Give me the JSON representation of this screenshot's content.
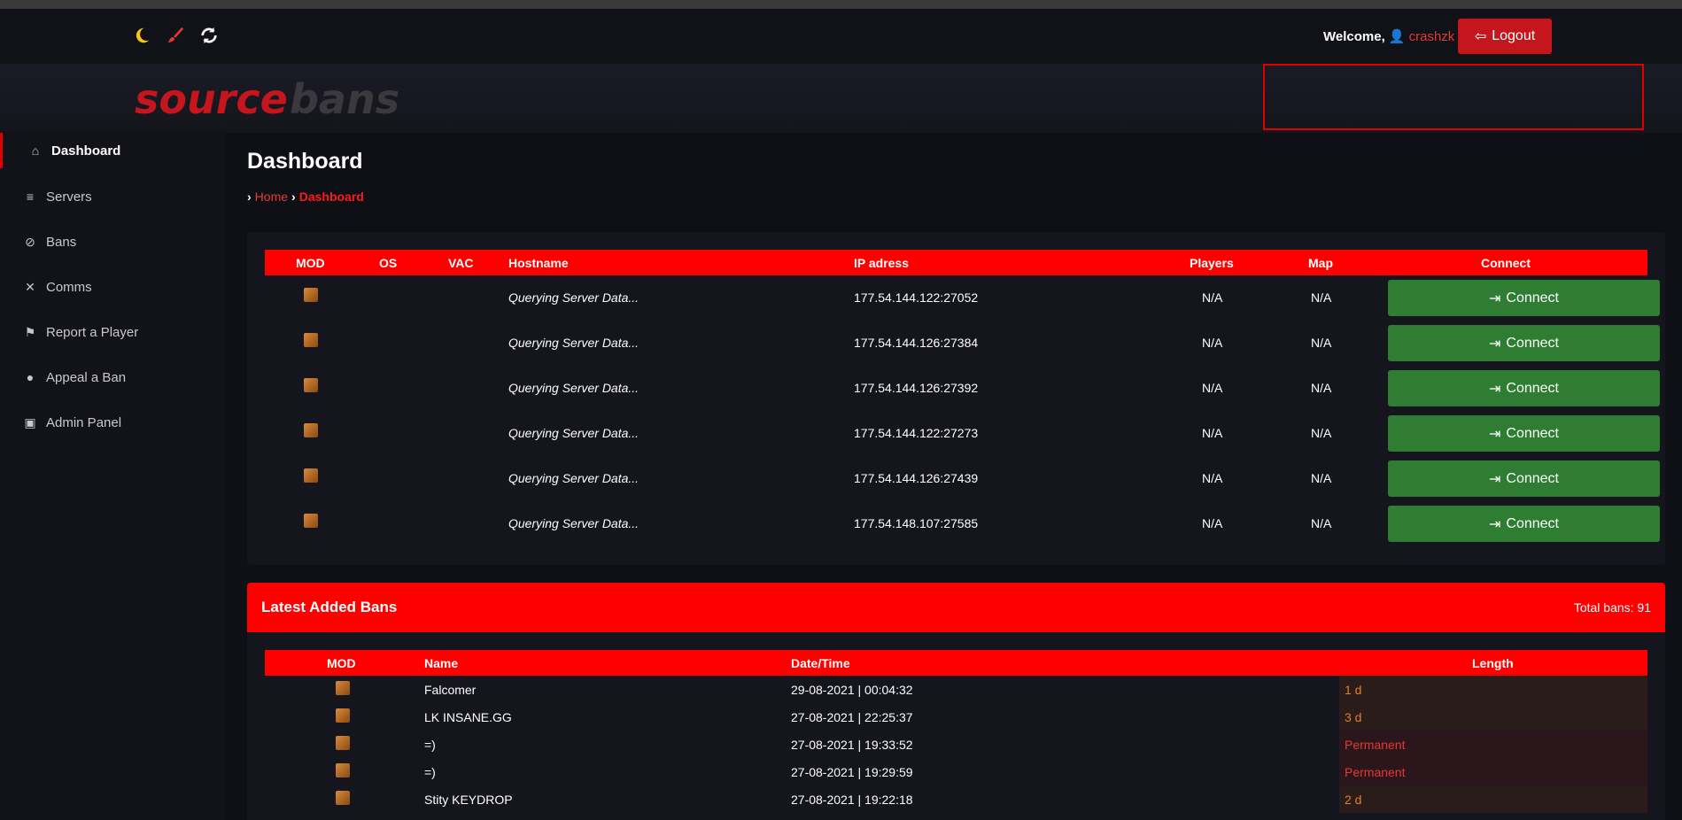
{
  "topbar": {
    "icons": [
      "moon-icon",
      "paint-brush-icon",
      "refresh-icon"
    ],
    "welcome_label": "Welcome,",
    "username": "crashzk",
    "logout_label": "Logout"
  },
  "header": {
    "logo_text_1": "source",
    "logo_text_2": "bans"
  },
  "sidebar": {
    "items": [
      {
        "label": "Dashboard",
        "icon": "home-icon"
      },
      {
        "label": "Servers",
        "icon": "server-icon"
      },
      {
        "label": "Bans",
        "icon": "ban-icon"
      },
      {
        "label": "Comms",
        "icon": "mic-off-icon"
      },
      {
        "label": "Report a Player",
        "icon": "flag-icon"
      },
      {
        "label": "Appeal a Ban",
        "icon": "user-lock-icon"
      },
      {
        "label": "Admin Panel",
        "icon": "lock-icon"
      }
    ]
  },
  "page": {
    "title": "Dashboard",
    "breadcrumb": {
      "home": "Home",
      "current": "Dashboard"
    }
  },
  "servers": {
    "columns": [
      "MOD",
      "OS",
      "VAC",
      "Hostname",
      "IP adress",
      "Players",
      "Map",
      "Connect"
    ],
    "rows": [
      {
        "hostname": "Querying Server Data...",
        "ip": "177.54.144.122:27052",
        "players": "N/A",
        "map": "N/A",
        "connect": "Connect"
      },
      {
        "hostname": "Querying Server Data...",
        "ip": "177.54.144.126:27384",
        "players": "N/A",
        "map": "N/A",
        "connect": "Connect"
      },
      {
        "hostname": "Querying Server Data...",
        "ip": "177.54.144.126:27392",
        "players": "N/A",
        "map": "N/A",
        "connect": "Connect"
      },
      {
        "hostname": "Querying Server Data...",
        "ip": "177.54.144.122:27273",
        "players": "N/A",
        "map": "N/A",
        "connect": "Connect"
      },
      {
        "hostname": "Querying Server Data...",
        "ip": "177.54.144.126:27439",
        "players": "N/A",
        "map": "N/A",
        "connect": "Connect"
      },
      {
        "hostname": "Querying Server Data...",
        "ip": "177.54.148.107:27585",
        "players": "N/A",
        "map": "N/A",
        "connect": "Connect"
      }
    ]
  },
  "bans": {
    "title": "Latest Added Bans",
    "total": "Total bans: 91",
    "columns": [
      "MOD",
      "Name",
      "Date/Time",
      "Length"
    ],
    "rows": [
      {
        "name": "Falcomer",
        "datetime": "29-08-2021 | 00:04:32",
        "length": "1 d",
        "permanent": false
      },
      {
        "name": "LK INSANE.GG",
        "datetime": "27-08-2021 | 22:25:37",
        "length": "3 d",
        "permanent": false
      },
      {
        "name": "=)",
        "datetime": "27-08-2021 | 19:33:52",
        "length": "Permanent",
        "permanent": true
      },
      {
        "name": "=)",
        "datetime": "27-08-2021 | 19:29:59",
        "length": "Permanent",
        "permanent": true
      },
      {
        "name": "Stity KEYDROP",
        "datetime": "27-08-2021 | 19:22:18",
        "length": "2 d",
        "permanent": false
      }
    ]
  },
  "colors": {
    "accent": "#ff0000",
    "connect": "#2e7d32",
    "background": "#0f1015"
  }
}
